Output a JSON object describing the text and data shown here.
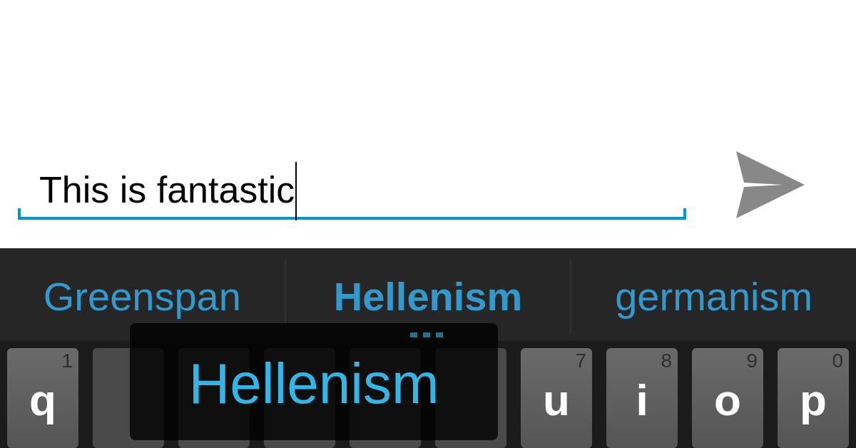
{
  "message_field": {
    "value": "This is fantastic",
    "focused": true
  },
  "suggestions": [
    {
      "text": "Greenspan",
      "selected": false
    },
    {
      "text": "Hellenism",
      "selected": true
    },
    {
      "text": "germanism",
      "selected": false
    }
  ],
  "preview_popup": {
    "text": "Hellenism"
  },
  "keys": [
    {
      "letter": "q",
      "number": "1",
      "covered": false
    },
    {
      "covered": true
    },
    {
      "covered": true
    },
    {
      "covered": true
    },
    {
      "covered": true
    },
    {
      "covered": true
    },
    {
      "letter": "u",
      "number": "7",
      "covered": false
    },
    {
      "letter": "i",
      "number": "8",
      "covered": false
    },
    {
      "letter": "o",
      "number": "9",
      "covered": false
    },
    {
      "letter": "p",
      "number": "0",
      "covered": false
    }
  ]
}
